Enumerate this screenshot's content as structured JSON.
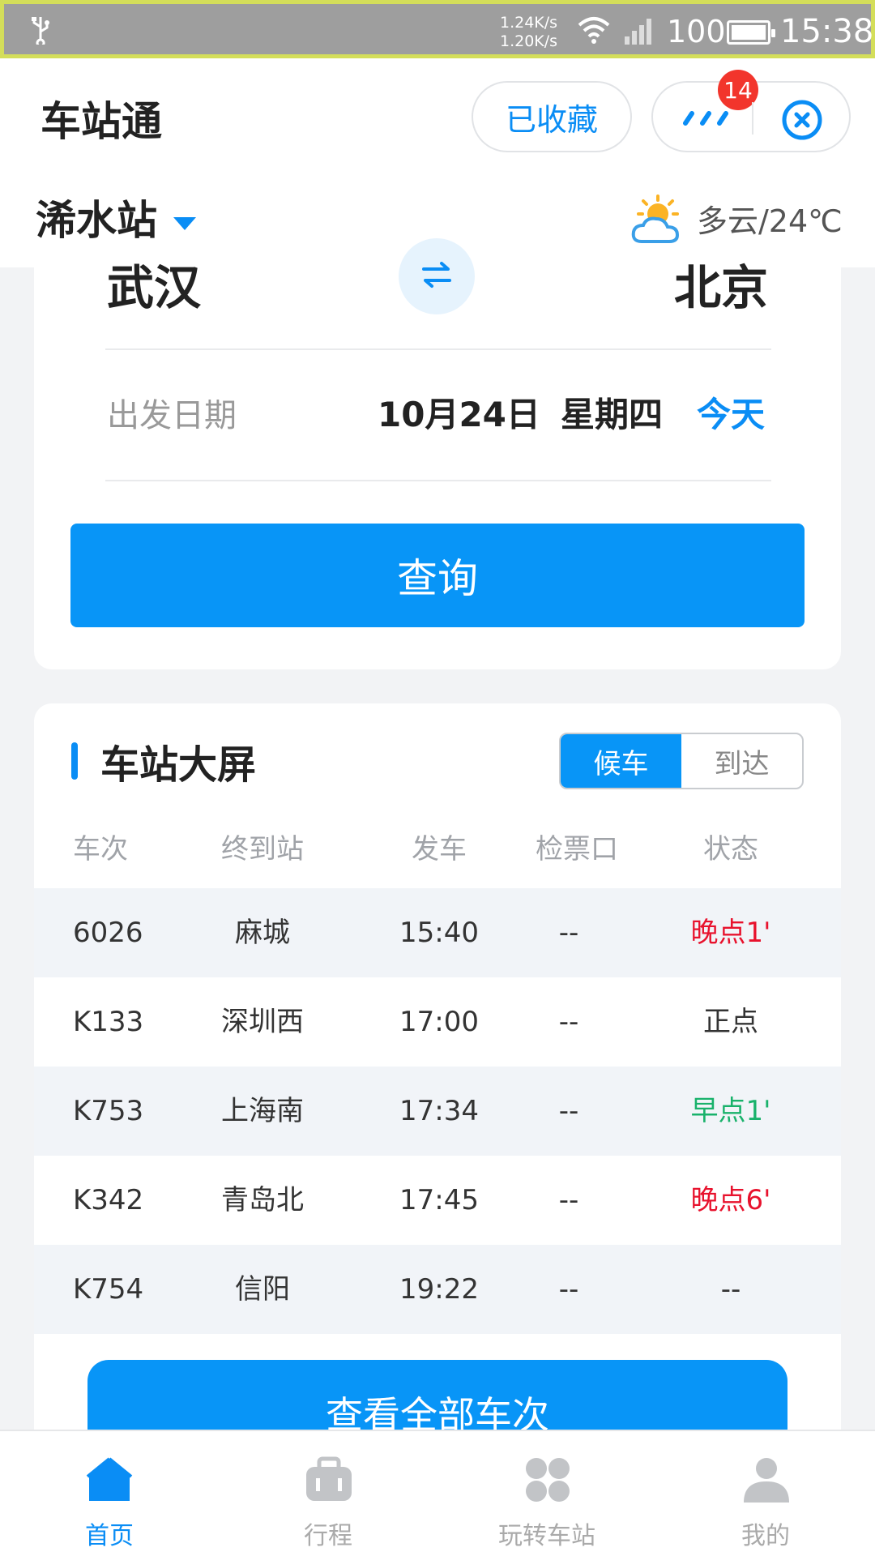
{
  "status_bar": {
    "net_down": "1.24K/s",
    "net_up": "1.20K/s",
    "battery": "100",
    "time": "15:38"
  },
  "header": {
    "app_title": "车站通",
    "favorites_label": "已收藏",
    "badge_count": "14",
    "station_name": "浠水站",
    "weather_text": "多云/24℃"
  },
  "search": {
    "from_city": "武汉",
    "to_city": "北京",
    "date_label": "出发日期",
    "date_value": "10月24日",
    "weekday": "星期四",
    "today_label": "今天",
    "query_label": "查询"
  },
  "screen": {
    "title": "车站大屏",
    "tabs": [
      "候车",
      "到达"
    ],
    "active_tab": "候车",
    "columns": [
      "车次",
      "终到站",
      "发车",
      "检票口",
      "状态"
    ],
    "rows": [
      {
        "train": "6026",
        "dest": "麻城",
        "depart": "15:40",
        "gate": "--",
        "status": "晚点1'",
        "status_color": "#e8122d"
      },
      {
        "train": "K133",
        "dest": "深圳西",
        "depart": "17:00",
        "gate": "--",
        "status": "正点",
        "status_color": "#333333"
      },
      {
        "train": "K753",
        "dest": "上海南",
        "depart": "17:34",
        "gate": "--",
        "status": "早点1'",
        "status_color": "#19b26b"
      },
      {
        "train": "K342",
        "dest": "青岛北",
        "depart": "17:45",
        "gate": "--",
        "status": "晚点6'",
        "status_color": "#e8122d"
      },
      {
        "train": "K754",
        "dest": "信阳",
        "depart": "19:22",
        "gate": "--",
        "status": "--",
        "status_color": "#333333"
      }
    ],
    "view_all_label": "查看全部车次"
  },
  "nav": {
    "items": [
      {
        "label": "首页",
        "icon": "home-icon",
        "active": true
      },
      {
        "label": "行程",
        "icon": "briefcase-icon",
        "active": false
      },
      {
        "label": "玩转车站",
        "icon": "grid-icon",
        "active": false
      },
      {
        "label": "我的",
        "icon": "user-icon",
        "active": false
      }
    ]
  },
  "colors": {
    "primary": "#0895f7",
    "late": "#e8122d",
    "early": "#19b26b",
    "badge": "#f2352c"
  }
}
